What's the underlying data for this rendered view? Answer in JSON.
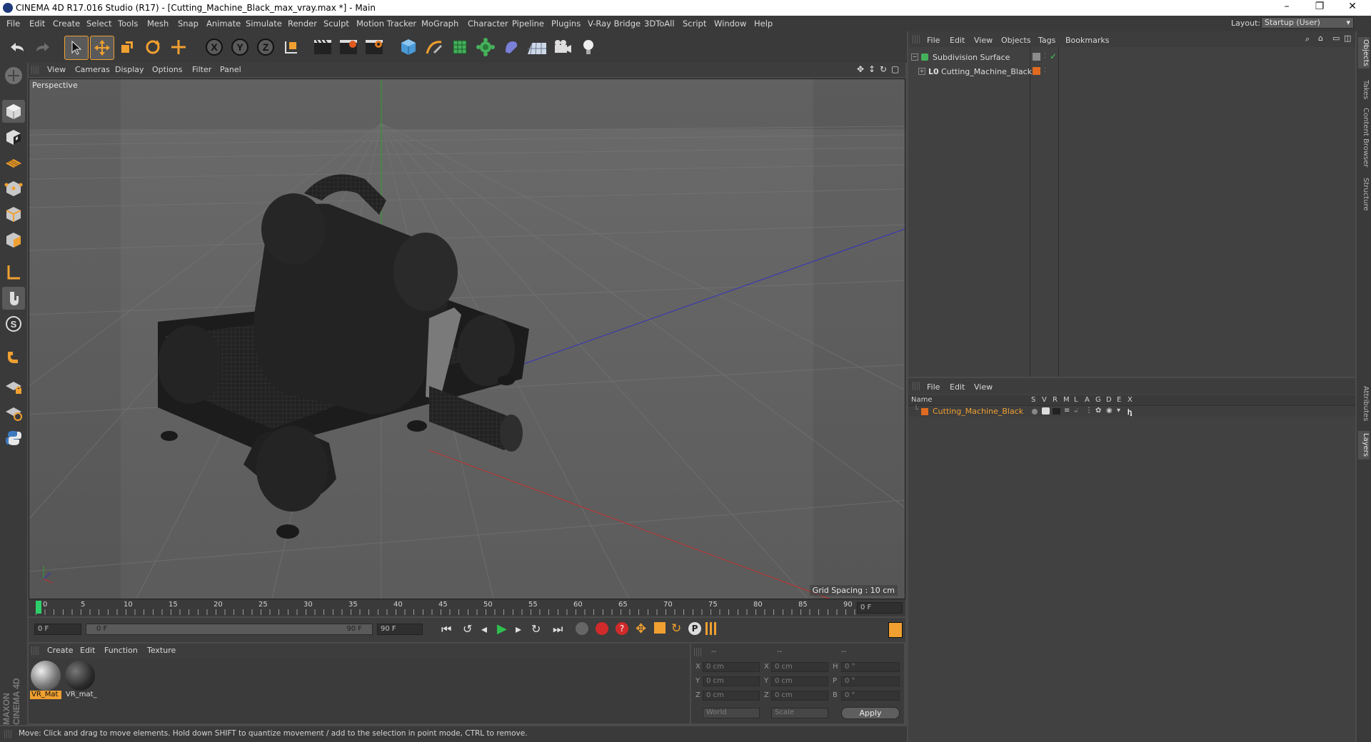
{
  "window": {
    "title": "CINEMA 4D R17.016 Studio (R17) - [Cutting_Machine_Black_max_vray.max *] - Main",
    "controls": [
      "–",
      "❐",
      "✕"
    ]
  },
  "menubar": {
    "items": [
      "File",
      "Edit",
      "Create",
      "Select",
      "Tools",
      "Mesh",
      "Snap",
      "Animate",
      "Simulate",
      "Render",
      "Sculpt",
      "Motion Tracker",
      "MoGraph",
      "Character",
      "Pipeline",
      "Plugins",
      "V-Ray Bridge",
      "3DToAll",
      "Script",
      "Window",
      "Help"
    ],
    "layout_label": "Layout:",
    "layout_value": "Startup (User)"
  },
  "viewport": {
    "menu": [
      "View",
      "Cameras",
      "Display",
      "Options",
      "Filter",
      "Panel"
    ],
    "camera_label": "Perspective",
    "grid_spacing": "Grid Spacing : 10 cm"
  },
  "timeline": {
    "ticks": [
      "0",
      "5",
      "10",
      "15",
      "20",
      "25",
      "30",
      "35",
      "40",
      "45",
      "50",
      "55",
      "60",
      "65",
      "70",
      "75",
      "80",
      "85",
      "90"
    ],
    "current_frame_field": "0 F",
    "start_field": "0 F",
    "range_start": "0 F",
    "range_end": "90 F",
    "end_field": "90 F"
  },
  "material_manager": {
    "menu": [
      "Create",
      "Edit",
      "Function",
      "Texture"
    ],
    "materials": [
      {
        "label": "VR_Mat",
        "selected": true
      },
      {
        "label": "VR_mat_",
        "selected": false
      }
    ]
  },
  "coordinates": {
    "headers": [
      "--",
      "--",
      "--"
    ],
    "rows": [
      {
        "axis": "X",
        "pos": "0 cm",
        "axis2": "X",
        "size": "0 cm",
        "rot_label": "H",
        "rot": "0 °"
      },
      {
        "axis": "Y",
        "pos": "0 cm",
        "axis2": "Y",
        "size": "0 cm",
        "rot_label": "P",
        "rot": "0 °"
      },
      {
        "axis": "Z",
        "pos": "0 cm",
        "axis2": "Z",
        "size": "0 cm",
        "rot_label": "B",
        "rot": "0 °"
      }
    ],
    "mode_world": "World",
    "mode_scale": "Scale",
    "apply": "Apply"
  },
  "status": "Move: Click and drag to move elements. Hold down SHIFT to quantize movement / add to the selection in point mode, CTRL to remove.",
  "object_manager": {
    "menu": [
      "File",
      "Edit",
      "View",
      "Objects",
      "Tags",
      "Bookmarks"
    ],
    "objects": [
      {
        "name": "Subdivision Surface"
      },
      {
        "name": "Cutting_Machine_Black"
      }
    ]
  },
  "layer_manager": {
    "menu": [
      "File",
      "Edit",
      "View"
    ],
    "columns": [
      "Name",
      "S",
      "V",
      "R",
      "M",
      "L",
      "A",
      "G",
      "D",
      "E",
      "X"
    ],
    "layers": [
      {
        "name": "Cutting_Machine_Black"
      }
    ]
  },
  "right_tabs": [
    "Objects",
    "Takes",
    "Content Browser",
    "Structure",
    "Attributes",
    "Layers"
  ],
  "brand": "MAXON CINEMA 4D",
  "colors": {
    "accent_orange": "#f0a030",
    "axis_x": "#c03030",
    "axis_y": "#30a030",
    "axis_z": "#3030c0",
    "selected_layer": "#f0a030"
  }
}
